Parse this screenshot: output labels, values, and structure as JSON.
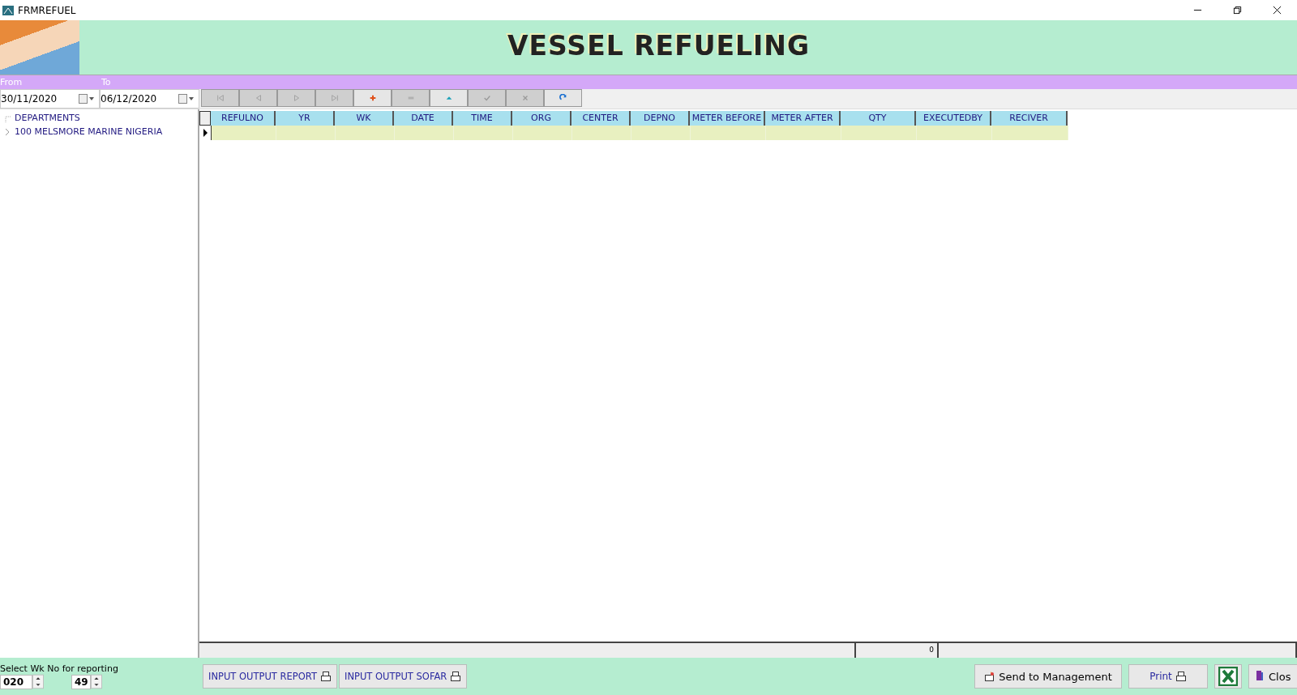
{
  "window": {
    "title": "FRMREFUEL"
  },
  "banner": {
    "title": "VESSEL REFUELING"
  },
  "filter": {
    "from_label": "From",
    "to_label": "To",
    "from_date": "30/11/2020",
    "to_date": "06/12/2020"
  },
  "navigator": [
    {
      "kind": "first",
      "disabled": true
    },
    {
      "kind": "prev",
      "disabled": true
    },
    {
      "kind": "next",
      "disabled": true
    },
    {
      "kind": "last",
      "disabled": true
    },
    {
      "kind": "add",
      "disabled": false
    },
    {
      "kind": "delete",
      "disabled": true
    },
    {
      "kind": "edit",
      "disabled": false
    },
    {
      "kind": "post",
      "disabled": true
    },
    {
      "kind": "cancel",
      "disabled": true
    },
    {
      "kind": "refresh",
      "disabled": false
    }
  ],
  "tree": [
    {
      "label": "DEPARTMENTS",
      "expanded": true,
      "children": [
        {
          "label": "100  MELSMORE MARINE NIGERIA",
          "expanded": false
        }
      ]
    }
  ],
  "table": {
    "columns": [
      "REFULNO",
      "YR",
      "WK",
      "DATE",
      "TIME",
      "ORG",
      "CENTER",
      "DEPNO",
      "METER BEFORE",
      "METER AFTER",
      "QTY",
      "EXECUTEDBY",
      "RECIVER"
    ]
  },
  "status_bar": {
    "count": "0"
  },
  "report": {
    "label": "Select Wk No for reporting",
    "year": "020",
    "week": "49"
  },
  "buttons": [
    {
      "kind": "print",
      "label": "INPUT OUTPUT REPORT"
    },
    {
      "kind": "print",
      "label": "INPUT OUTPUT SOFAR"
    }
  ],
  "actions": [
    {
      "kind": "send",
      "label": "Send to Management"
    },
    {
      "kind": "print",
      "label": "Print"
    },
    {
      "kind": "excel"
    },
    {
      "kind": "close",
      "label": "Clos"
    }
  ]
}
